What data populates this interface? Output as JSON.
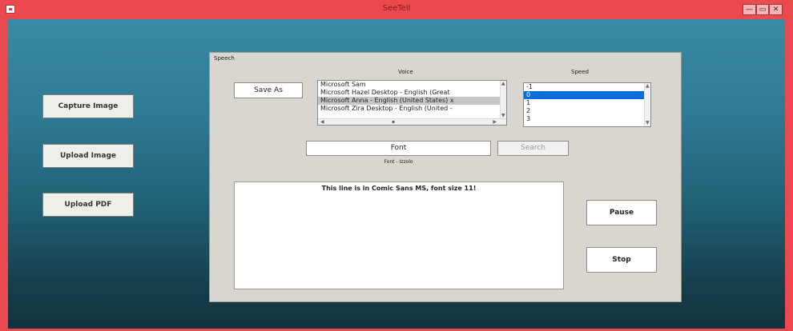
{
  "window": {
    "title": "SeeTell",
    "controls": {
      "minimize": "—",
      "maximize": "▭",
      "close": "✕"
    }
  },
  "left_buttons": [
    {
      "label": "Capture Image"
    },
    {
      "label": "Upload Image"
    },
    {
      "label": "Upload PDF"
    }
  ],
  "speech": {
    "group_label": "Speech",
    "voice_label": "Voice",
    "speed_label": "Speed",
    "save_as_label": "Save As",
    "voices": [
      "Microsoft Sam",
      "Microsoft Hazel Desktop - English (Great",
      "Microsoft Anna - English (United States) x",
      "Microsoft Zira Desktop - English (United -"
    ],
    "selected_voice_index": 2,
    "speeds": [
      "-1",
      "0",
      "1",
      "2",
      "3"
    ],
    "selected_speed_index": 1,
    "font_button_label": "Font",
    "search_button_label": "Search",
    "font_caption": "Font - Izzolo",
    "text_content": "This line is in Comic Sans MS, font size 11!",
    "pause_label": "Pause",
    "stop_label": "Stop"
  },
  "colors": {
    "titlebar": "#e9494f",
    "selection_blue": "#0a6ed8",
    "panel_bg": "#d8d6ce"
  }
}
